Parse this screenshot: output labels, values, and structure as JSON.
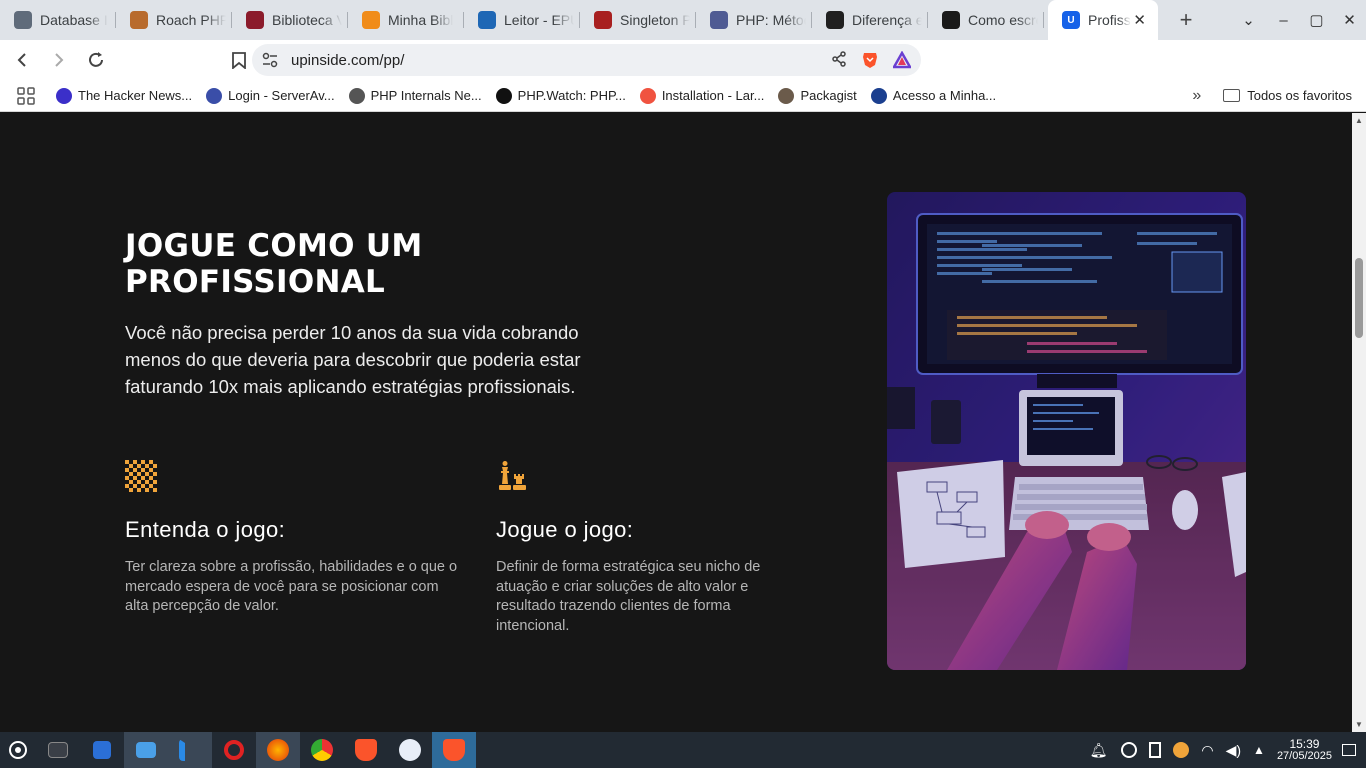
{
  "browser": {
    "tabs": [
      {
        "title": "Database I",
        "color": "#5f6b7a"
      },
      {
        "title": "Roach PHP",
        "color": "#b86b2d"
      },
      {
        "title": "Biblioteca V",
        "color": "#8b1b2b"
      },
      {
        "title": "Minha Bibl",
        "color": "#f08c1a"
      },
      {
        "title": "Leitor - EPU",
        "color": "#1e67b5"
      },
      {
        "title": "Singleton P",
        "color": "#a82020"
      },
      {
        "title": "PHP: Métod",
        "color": "#4f5b93"
      },
      {
        "title": "Diferença e",
        "color": "#202020"
      },
      {
        "title": "Como escre",
        "color": "#1a1a1a"
      }
    ],
    "active_tab": {
      "title": "Profiss",
      "color": "#1662e8",
      "favicon_letter": "U"
    },
    "new_tab_symbol": "+",
    "url": "upinside.com/pp/",
    "bookmarks": [
      {
        "label": "The Hacker News...",
        "color": "#3b2fc9"
      },
      {
        "label": "Login - ServerAv...",
        "color": "#3a4ea8"
      },
      {
        "label": "PHP Internals Ne...",
        "color": "#555555"
      },
      {
        "label": "PHP.Watch: PHP...",
        "color": "#111111"
      },
      {
        "label": "Installation - Lar...",
        "color": "#f05340"
      },
      {
        "label": "Packagist",
        "color": "#6b5b4b"
      },
      {
        "label": "Acesso a Minha...",
        "color": "#1b3f8f"
      }
    ],
    "all_bookmarks": "Todos os favoritos"
  },
  "page": {
    "heading_line1": "JOGUE COMO UM",
    "heading_line2": "PROFISSIONAL",
    "lead": "Você não precisa perder 10 anos da sua vida cobrando menos do que deveria para descobrir que poderia estar faturando 10x mais aplicando estratégias profissionais.",
    "features": [
      {
        "icon": "checkerboard-icon",
        "title": "Entenda o jogo:",
        "text": "Ter clareza sobre a profissão, habilidades e o que o mercado espera de você para se posicionar com alta percepção de valor."
      },
      {
        "icon": "chess-pieces-icon",
        "title": "Jogue o jogo:",
        "text": "Definir de forma estratégica seu nicho de atuação e criar soluções de alto valor e resultado trazendo clientes de forma intencional."
      }
    ],
    "accent": "#f0a43a"
  },
  "taskbar": {
    "time": "15:39",
    "date": "27/05/2025"
  }
}
